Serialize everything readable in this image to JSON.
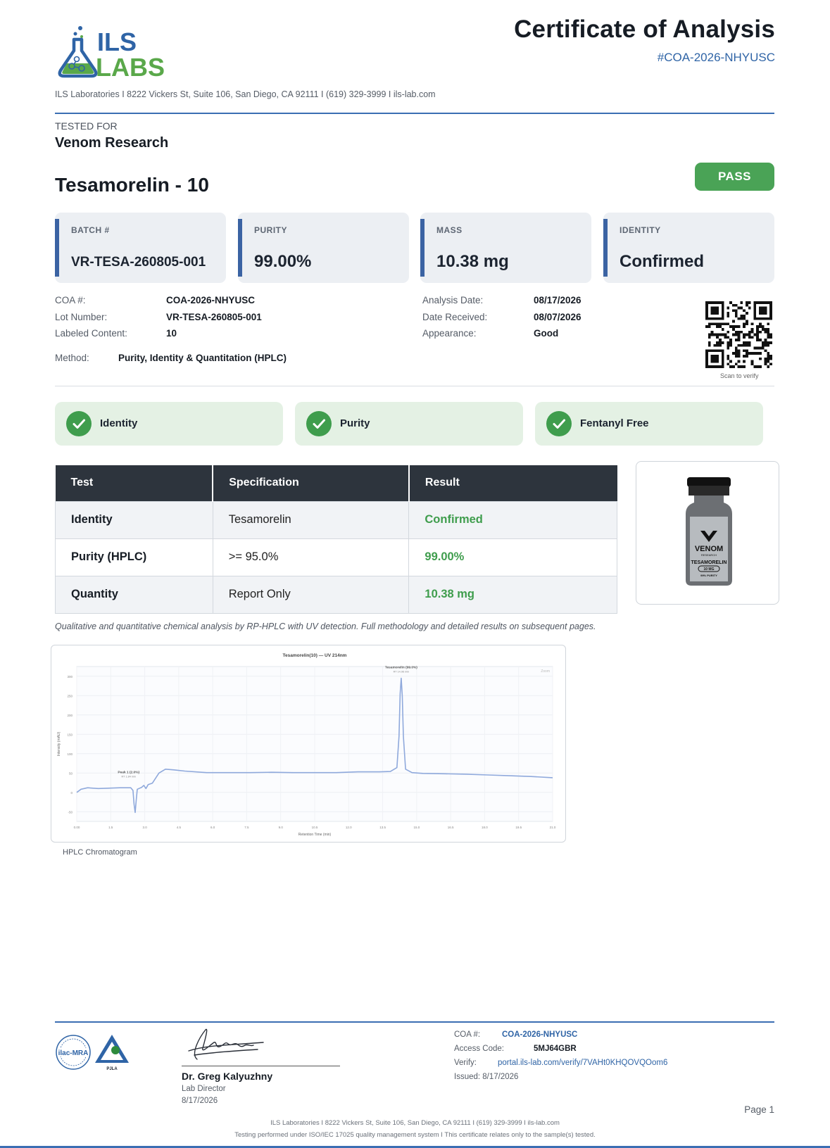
{
  "header": {
    "logo_top": "ILS",
    "logo_bottom": "LABS",
    "title": "Certificate of Analysis",
    "coa_id": "#COA-2026-NHYUSC",
    "address": "ILS Laboratories  I  8222 Vickers St, Suite 106, San Diego, CA 92111  I  (619) 329-3999  I  ils-lab.com"
  },
  "client": {
    "label": "TESTED FOR",
    "name": "Venom Research"
  },
  "product": {
    "name": "Tesamorelin - 10",
    "status": "PASS",
    "status_color": "#4aa356"
  },
  "cards": [
    {
      "label": "BATCH #",
      "value": "VR-TESA-260805-001"
    },
    {
      "label": "PURITY",
      "value": "99.00%"
    },
    {
      "label": "MASS",
      "value": "10.38 mg"
    },
    {
      "label": "IDENTITY",
      "value": "Confirmed"
    }
  ],
  "details": {
    "coa_label": "COA #:",
    "coa_value": "COA-2026-NHYUSC",
    "lot_label": "Lot Number:",
    "lot_value": "VR-TESA-260805-001",
    "content_label": "Labeled Content:",
    "content_value": "10",
    "method_label": "Method:",
    "method_value": "Purity, Identity & Quantitation (HPLC)",
    "analysis_label": "Analysis Date:",
    "analysis_value": "08/17/2026",
    "received_label": "Date Received:",
    "received_value": "08/07/2026",
    "appearance_label": "Appearance:",
    "appearance_value": "Good",
    "qr_caption": "Scan to verify"
  },
  "checks": [
    {
      "label": "Identity"
    },
    {
      "label": "Purity"
    },
    {
      "label": "Fentanyl Free"
    }
  ],
  "table": {
    "headers": [
      "Test",
      "Specification",
      "Result"
    ],
    "rows": [
      {
        "test": "Identity",
        "spec": "Tesamorelin",
        "result": "Confirmed"
      },
      {
        "test": "Purity (HPLC)",
        "spec": ">= 95.0%",
        "result": "99.00%"
      },
      {
        "test": "Quantity",
        "spec": "Report Only",
        "result": "10.38 mg"
      }
    ]
  },
  "vial": {
    "brand": "VENOM",
    "sub": "RESEARCH",
    "product": "TESAMORELIN",
    "dose": "10 MG",
    "purity": "99% PURITY"
  },
  "method_note": "Qualitative and quantitative chemical analysis by RP-HPLC with UV detection. Full methodology and detailed results on subsequent pages.",
  "chart_caption": "HPLC Chromatogram",
  "chart_data": {
    "type": "line",
    "title": "Tesamorelin(10) — UV 214nm",
    "xlabel": "Retention Time (min)",
    "ylabel": "Intensity (mAU)",
    "x_ticks": [
      "0.00",
      "1.5",
      "3.0",
      "4.5",
      "6.0",
      "7.5",
      "9.0",
      "10.5",
      "12.0",
      "13.5",
      "15.0",
      "16.5",
      "18.0",
      "19.5",
      "21.0"
    ],
    "y_ticks": [
      "-50",
      "0",
      "50",
      "100",
      "150",
      "200",
      "250",
      "300"
    ],
    "xlim": [
      0,
      22
    ],
    "ylim": [
      -75,
      325
    ],
    "line_color": "#8fa9dc",
    "series": [
      {
        "x": [
          0,
          0.2,
          0.5,
          1.0,
          2.0,
          2.5,
          2.6,
          2.65,
          2.7,
          2.75,
          2.8,
          3.0,
          3.1,
          3.2,
          3.3,
          3.5,
          3.8,
          4.1,
          4.5,
          5.0,
          6.0,
          7.0,
          8.0,
          9.0,
          10.0,
          11.0,
          12.0,
          13.0,
          14.0,
          14.5,
          14.8,
          14.9,
          14.95,
          15.0,
          15.05,
          15.1,
          15.2,
          15.5,
          16.0,
          17.0,
          18.0,
          19.0,
          20.0,
          21.0,
          22.0
        ],
        "y": [
          0,
          8,
          12,
          10,
          12,
          12,
          5,
          -30,
          -52,
          -20,
          8,
          13,
          18,
          10,
          20,
          24,
          50,
          60,
          58,
          55,
          51,
          51,
          51,
          52,
          51,
          51,
          51,
          53,
          53,
          54,
          64,
          145,
          255,
          295,
          250,
          145,
          60,
          51,
          49,
          48,
          47,
          45,
          43,
          41,
          38
        ]
      }
    ],
    "annotations": [
      {
        "label": "Peak 1 (2.0%)",
        "sub": "RT 1.84 min",
        "x": 2.4,
        "y": 24
      },
      {
        "label": "Tesamorelin (99.0%)",
        "sub": "RT 14.96 min",
        "x": 15.0,
        "y": 295
      }
    ],
    "legend_hint": "Zoom",
    "grid": true
  },
  "footer": {
    "seal_left": "ilac-MRA",
    "seal_right": "PJLA",
    "signer_name": "Dr. Greg Kalyuzhny",
    "signer_role": "Lab Director",
    "signer_date": "8/17/2026",
    "coa_label": "COA #:",
    "coa_value": "COA-2026-NHYUSC",
    "access_label": "Access Code:",
    "access_value": "5MJ64GBR",
    "verify_label": "Verify:",
    "verify_value": "portal.ils-lab.com/verify/7VAHt0KHQOVQOom6",
    "issued": "Issued: 8/17/2026",
    "page": "Page 1",
    "line1": "ILS Laboratories  I  8222 Vickers St, Suite 106, San Diego, CA 92111  I  (619) 329-3999  I  ils-lab.com",
    "line2": "Testing performed under ISO/IEC 17025 quality management system  I  This certificate relates only to the sample(s) tested."
  }
}
